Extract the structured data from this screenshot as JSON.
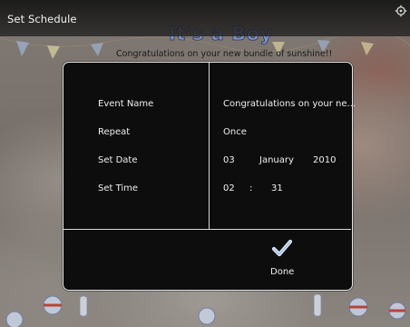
{
  "window": {
    "title": "Set Schedule"
  },
  "background": {
    "headline": "It's a Boy",
    "subline": "Congratulations on your new bundle of sunshine!!"
  },
  "dialog": {
    "fields": [
      {
        "label": "Event Name",
        "value": "Congratulations on your ne..."
      },
      {
        "label": "Repeat",
        "value": "Once"
      },
      {
        "label": "Set Date",
        "day": "03",
        "month": "January",
        "year": "2010"
      },
      {
        "label": "Set Time",
        "hour": "02",
        "separator": ":",
        "minute": "31"
      }
    ],
    "done_label": "Done",
    "done_icon": "checkmark-icon"
  },
  "colors": {
    "dialog_bg": "#0d0d0d",
    "dialog_border": "#e6e6e6",
    "check_icon": "#d9e6f5",
    "headline": "#7f92c4"
  }
}
